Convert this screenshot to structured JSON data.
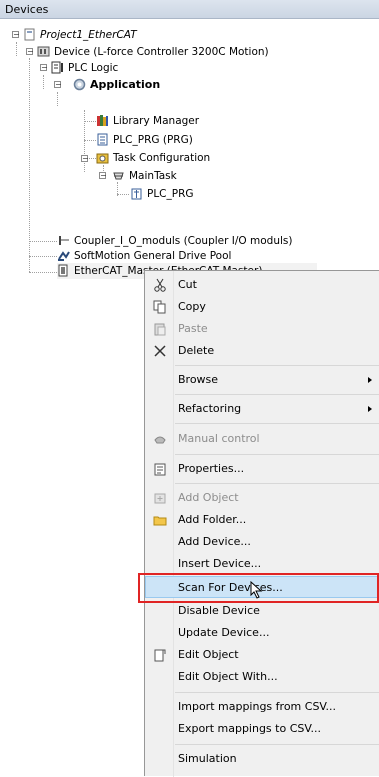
{
  "panel": {
    "title": "Devices"
  },
  "tree": {
    "project": "Project1_EtherCAT",
    "device": "Device (L-force Controller 3200C Motion)",
    "plc_logic": "PLC Logic",
    "application": "Application",
    "library_manager": "Library Manager",
    "plc_prg": "PLC_PRG (PRG)",
    "task_configuration": "Task Configuration",
    "main_task": "MainTask",
    "main_task_prg": "PLC_PRG",
    "coupler": "Coupler_I_O_moduls (Coupler I/O moduls)",
    "softmotion": "SoftMotion General Drive Pool",
    "ethercat_master": "EtherCAT_Master (EtherCAT Master)"
  },
  "context_menu": {
    "cut": "Cut",
    "copy": "Copy",
    "paste": "Paste",
    "delete": "Delete",
    "browse": "Browse",
    "refactoring": "Refactoring",
    "manual_control": "Manual control",
    "properties": "Properties...",
    "add_object": "Add Object",
    "add_folder": "Add Folder...",
    "add_device": "Add Device...",
    "insert_device": "Insert Device...",
    "scan_for_devices": "Scan For Devices...",
    "disable_device": "Disable Device",
    "update_device": "Update Device...",
    "edit_object": "Edit Object",
    "edit_object_with": "Edit Object With...",
    "import_mappings": "Import mappings from CSV...",
    "export_mappings": "Export mappings to CSV...",
    "simulation": "Simulation"
  },
  "colors": {
    "highlight": "#cce4f7",
    "annotation": "#e02424"
  }
}
